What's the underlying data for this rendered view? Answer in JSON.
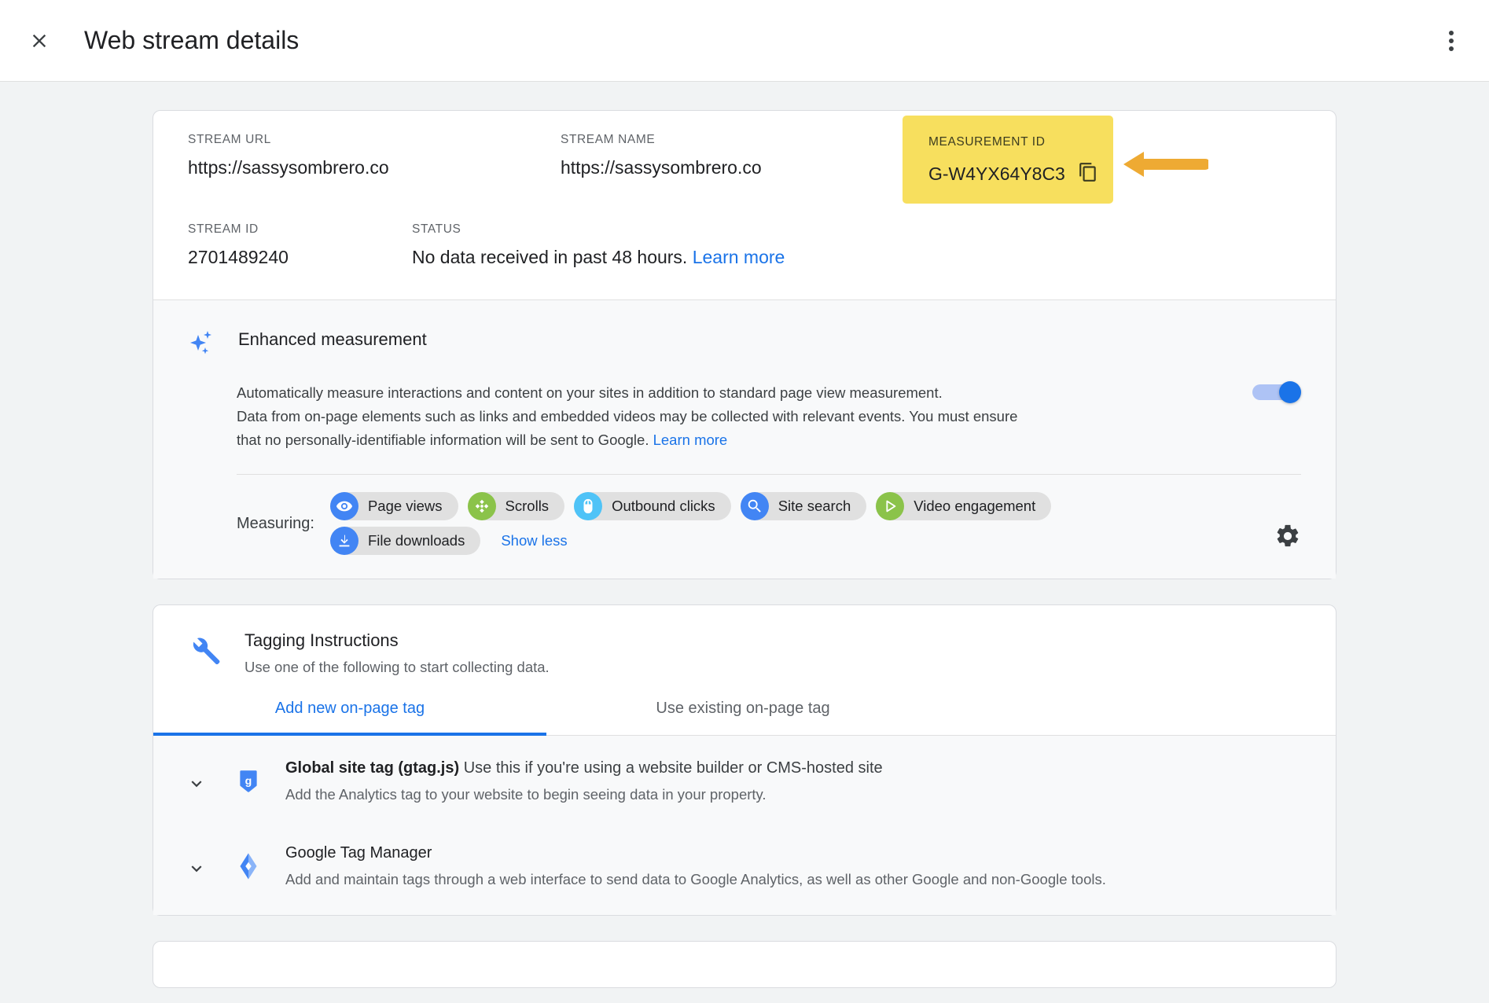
{
  "header": {
    "title": "Web stream details",
    "close_icon": "close-icon",
    "menu_icon": "more-vert-icon"
  },
  "stream": {
    "url_label": "STREAM URL",
    "url_value": "https://sassysombrero.co",
    "name_label": "STREAM NAME",
    "name_value": "https://sassysombrero.co",
    "measurement_id_label": "MEASUREMENT ID",
    "measurement_id_value": "G-W4YX64Y8C3",
    "copy_icon": "copy-icon",
    "highlight_color": "#f7df5e",
    "arrow_color": "#eeaa33",
    "stream_id_label": "STREAM ID",
    "stream_id_value": "2701489240",
    "status_label": "STATUS",
    "status_value": "No data received in past 48 hours.",
    "status_link": "Learn more"
  },
  "enhanced_measurement": {
    "icon": "sparkle-icon",
    "title": "Enhanced measurement",
    "description_line1": "Automatically measure interactions and content on your sites in addition to standard page view measurement.",
    "description_line2": "Data from on-page elements such as links and embedded videos may be collected with relevant events. You must ensure",
    "description_line3": "that no personally-identifiable information will be sent to Google.",
    "learn_more": "Learn more",
    "toggle_on": true,
    "toggle_color": "#1a73e8",
    "measuring_label": "Measuring:",
    "chips": [
      {
        "label": "Page views",
        "icon": "eye-icon",
        "color": "#4285f4"
      },
      {
        "label": "Scrolls",
        "icon": "scroll-icon",
        "color": "#8bc34a"
      },
      {
        "label": "Outbound clicks",
        "icon": "mouse-icon",
        "color": "#4fc3f7"
      },
      {
        "label": "Site search",
        "icon": "search-icon",
        "color": "#4285f4"
      },
      {
        "label": "Video engagement",
        "icon": "play-icon",
        "color": "#8bc34a"
      },
      {
        "label": "File downloads",
        "icon": "download-icon",
        "color": "#4285f4"
      }
    ],
    "show_less": "Show less",
    "settings_icon": "gear-icon"
  },
  "tagging": {
    "icon": "wrench-icon",
    "title": "Tagging Instructions",
    "subtitle": "Use one of the following to start collecting data.",
    "tabs": [
      {
        "label": "Add new on-page tag",
        "active": true
      },
      {
        "label": "Use existing on-page tag",
        "active": false
      }
    ],
    "options": [
      {
        "title": "Global site tag (gtag.js)",
        "title_suffix": "Use this if you're using a website builder or CMS-hosted site",
        "description": "Add the Analytics tag to your website to begin seeing data in your property.",
        "icon": "gtag-icon",
        "chevron": "chevron-down-icon"
      },
      {
        "title": "Google Tag Manager",
        "title_suffix": "",
        "description": "Add and maintain tags through a web interface to send data to Google Analytics, as well as other Google and non-Google tools.",
        "icon": "tag-manager-icon",
        "chevron": "chevron-down-icon"
      }
    ]
  }
}
